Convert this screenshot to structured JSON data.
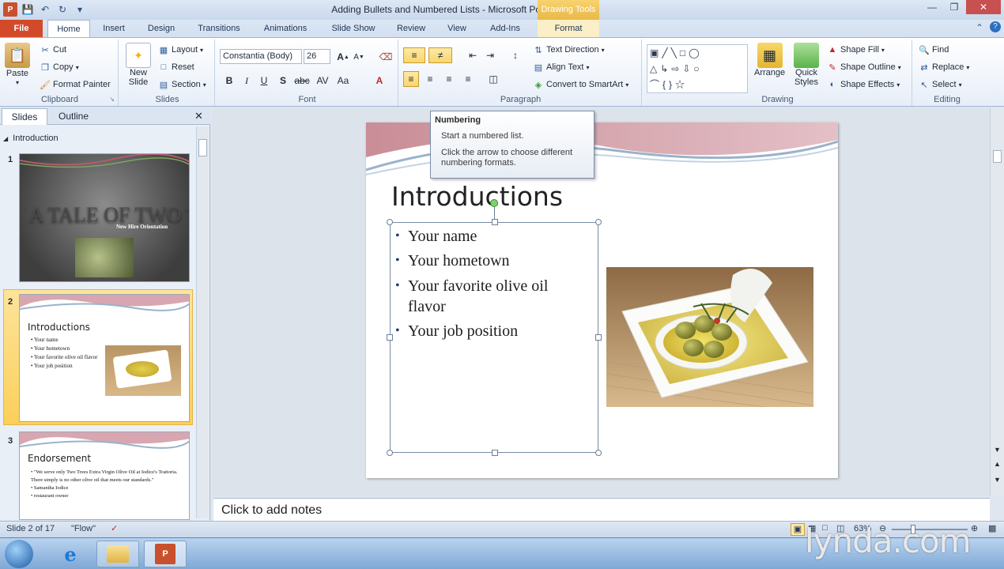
{
  "window": {
    "title": "Adding Bullets and Numbered Lists  -  Microsoft PowerPoint",
    "context_tab_group": "Drawing Tools"
  },
  "tabs": [
    "File",
    "Home",
    "Insert",
    "Design",
    "Transitions",
    "Animations",
    "Slide Show",
    "Review",
    "View",
    "Add-Ins",
    "Format"
  ],
  "ribbon": {
    "clipboard": {
      "label": "Clipboard",
      "paste": "Paste",
      "cut": "Cut",
      "copy": "Copy",
      "format_painter": "Format Painter"
    },
    "slides": {
      "label": "Slides",
      "new_slide": "New Slide",
      "layout": "Layout",
      "reset": "Reset",
      "section": "Section"
    },
    "font": {
      "label": "Font",
      "family": "Constantia (Body)",
      "size": "26"
    },
    "paragraph": {
      "label": "Paragraph",
      "text_direction": "Text Direction",
      "align_text": "Align Text",
      "convert_smartart": "Convert to SmartArt"
    },
    "drawing": {
      "label": "Drawing",
      "arrange": "Arrange",
      "quick_styles": "Quick Styles",
      "shape_fill": "Shape Fill",
      "shape_outline": "Shape Outline",
      "shape_effects": "Shape Effects"
    },
    "editing": {
      "label": "Editing",
      "find": "Find",
      "replace": "Replace",
      "select": "Select"
    }
  },
  "tooltip": {
    "title": "Numbering",
    "line1": "Start a numbered list.",
    "line2": "Click the arrow to choose different numbering formats."
  },
  "slides_pane": {
    "tab_slides": "Slides",
    "tab_outline": "Outline",
    "section": "Introduction",
    "thumbs": [
      {
        "num": "1",
        "title": "A TALE OF TWO TREES",
        "subtitle": "New Hire Orientation"
      },
      {
        "num": "2",
        "title": "Introductions",
        "bullets": [
          "Your name",
          "Your hometown",
          "Your favorite olive oil flavor",
          "Your job position"
        ]
      },
      {
        "num": "3",
        "title": "Endorsement",
        "bullets": [
          "\"We serve only Two Trees Extra Virgin Olive Oil at Iodice's Trattoria. There simply is no other olive oil that meets our standards.\"",
          "Samantha Iodice",
          "restaurant owner"
        ]
      }
    ]
  },
  "slide": {
    "title": "Introductions",
    "bullets": [
      "Your name",
      "Your hometown",
      "Your favorite olive oil flavor",
      "Your job position"
    ]
  },
  "notes": {
    "placeholder": "Click to add notes"
  },
  "status": {
    "slide_info": "Slide 2 of 17",
    "theme": "\"Flow\"",
    "zoom": "63%"
  },
  "watermark": "lynda.com",
  "colors": {
    "file_tab": "#d34a2b",
    "context_tab": "#e9b84a",
    "selected_thumb": "#fccf5a"
  }
}
